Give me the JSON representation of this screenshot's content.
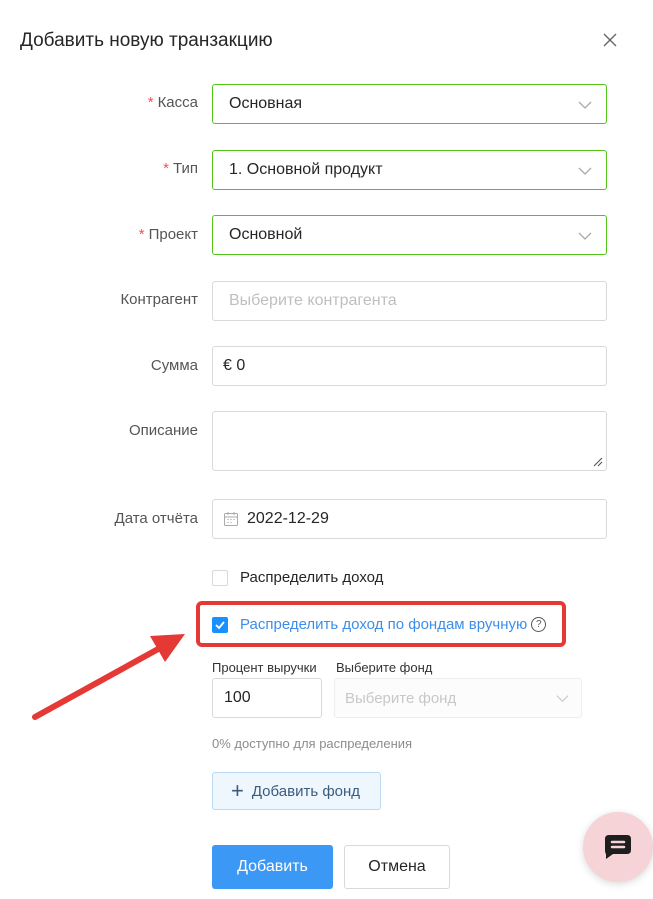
{
  "dialog": {
    "title": "Добавить новую транзакцию"
  },
  "form": {
    "kassa": {
      "label": "Касса",
      "value": "Основная",
      "required": "*"
    },
    "type": {
      "label": "Тип",
      "value": "1. Основной продукт",
      "required": "*"
    },
    "project": {
      "label": "Проект",
      "value": "Основной",
      "required": "*"
    },
    "counterparty": {
      "label": "Контрагент",
      "placeholder": "Выберите контрагента"
    },
    "amount": {
      "label": "Сумма",
      "value": "€ 0"
    },
    "description": {
      "label": "Описание",
      "value": ""
    },
    "report_date": {
      "label": "Дата отчёта",
      "value": "2022-12-29"
    },
    "distribute_income": {
      "label": "Распределить доход",
      "checked": false
    },
    "distribute_manual": {
      "label": "Распределить доход по фондам вручную",
      "checked": true,
      "help": "?"
    },
    "percent": {
      "label": "Процент выручки",
      "value": "100"
    },
    "fund": {
      "label": "Выберите фонд",
      "placeholder": "Выберите фонд"
    },
    "available_text": "0% доступно для распределения",
    "add_fund_label": "Добавить фонд"
  },
  "actions": {
    "submit": "Добавить",
    "cancel": "Отмена"
  },
  "colors": {
    "primary": "#3b98f5",
    "valid_border": "#52c41a",
    "required": "#ff4d4f",
    "highlight": "#e53935",
    "link": "#3d8eea"
  }
}
